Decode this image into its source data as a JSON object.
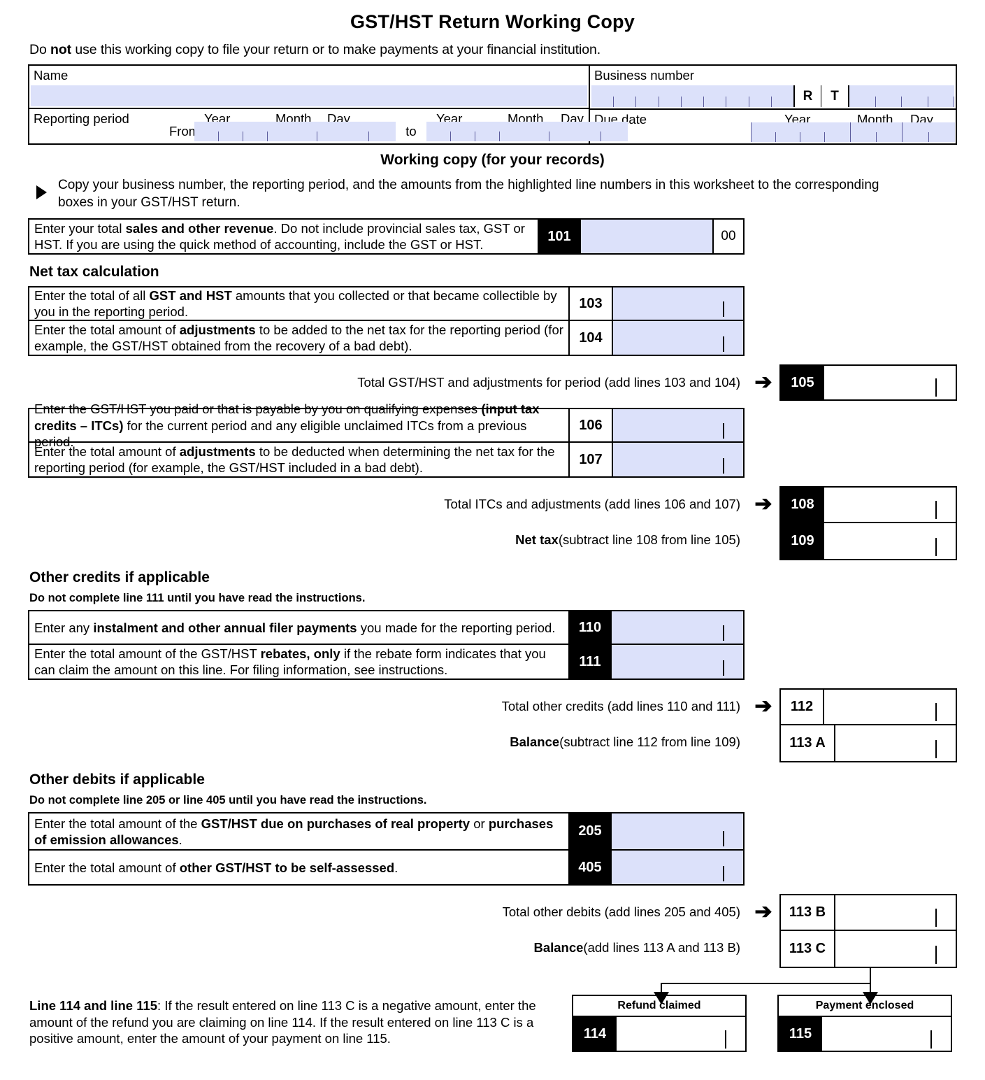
{
  "document": {
    "title": "GST/HST Return Working Copy",
    "subtitle_prefix": "Do ",
    "subtitle_bold": "not",
    "subtitle_suffix": " use this working copy to file your return or to make payments at your financial institution."
  },
  "identification": {
    "name_label": "Name",
    "business_number_label": "Business number",
    "rt_r": "R",
    "rt_t": "T",
    "reporting_period_label": "Reporting period",
    "from_label": "From",
    "to_label": "to",
    "due_date_label": "Due date",
    "year_label": "Year",
    "month_label": "Month",
    "day_label": "Day"
  },
  "working_copy": {
    "heading": "Working copy (for your records)",
    "instruction": "Copy your business number, the reporting period, and the amounts from the highlighted line numbers in this worksheet to the corresponding boxes in your GST/HST return."
  },
  "line_101": {
    "text_1": "Enter your total ",
    "bold_1": "sales and other revenue",
    "text_2": ". Do not include provincial sales tax, GST or HST. If you are using the quick method of accounting, include the GST or HST.",
    "number": "101",
    "cents": "00"
  },
  "net_tax": {
    "heading": "Net tax calculation",
    "line_103": {
      "text_1": "Enter the total of all ",
      "bold_1": "GST and HST",
      "text_2": " amounts that you collected or that became collectible by you in the reporting period.",
      "number": "103"
    },
    "line_104": {
      "text_1": "Enter the total amount of ",
      "bold_1": "adjustments",
      "text_2": " to be added to the net tax for the reporting period (for example, the GST/HST obtained from the recovery of a bad debt).",
      "number": "104"
    },
    "line_105": {
      "label": "Total GST/HST and adjustments for period (add lines 103 and 104)",
      "number": "105",
      "arrow": "➔"
    },
    "line_106": {
      "text_1": "Enter the GST/HST you paid or that is payable by you on qualifying expenses ",
      "bold_1": "(input tax credits – ITCs)",
      "text_2": " for the current period and any eligible unclaimed ITCs from a previous period.",
      "number": "106"
    },
    "line_107": {
      "text_1": "Enter the total amount of ",
      "bold_1": "adjustments",
      "text_2": " to be deducted when determining the net tax for the reporting period (for example, the GST/HST included in a bad debt).",
      "number": "107"
    },
    "line_108": {
      "label": "Total ITCs and adjustments (add lines 106 and 107)",
      "number": "108",
      "arrow": "➔"
    },
    "line_109": {
      "bold_label": "Net tax",
      "label": " (subtract line 108 from line 105)",
      "number": "109"
    }
  },
  "other_credits": {
    "heading": "Other credits if applicable",
    "subheading": "Do not complete line 111 until you have read the instructions.",
    "line_110": {
      "text_1": "Enter any ",
      "bold_1": "instalment and other annual filer payments",
      "text_2": " you made for the reporting period.",
      "number": "110"
    },
    "line_111": {
      "text_1": "Enter the total amount of the GST/HST ",
      "bold_1": "rebates, only",
      "text_2": " if the rebate form indicates that you can claim the amount on this line. For filing information, see instructions.",
      "number": "111"
    },
    "line_112": {
      "label": "Total other credits (add lines 110 and 111)",
      "number": "112",
      "arrow": "➔"
    },
    "line_113a": {
      "bold_label": "Balance",
      "label": " (subtract line 112 from line 109)",
      "number": "113 A"
    }
  },
  "other_debits": {
    "heading": "Other debits if applicable",
    "subheading": "Do not complete line 205 or line 405 until you have read the instructions.",
    "line_205": {
      "text_1": "Enter the total amount of the ",
      "bold_1": "GST/HST due on purchases of real property",
      "text_2": " or ",
      "bold_2": "purchases of emission allowances",
      "text_3": ".",
      "number": "205"
    },
    "line_405": {
      "text_1": "Enter the total amount of ",
      "bold_1": "other GST/HST to be self-assessed",
      "text_2": ".",
      "number": "405"
    },
    "line_113b": {
      "label": "Total other debits (add lines 205 and 405)",
      "number": "113 B",
      "arrow": "➔"
    },
    "line_113c": {
      "bold_label": "Balance",
      "label": " (add lines 113 A and 113 B)",
      "number": "113 C"
    }
  },
  "footer": {
    "note_bold": "Line 114 and line 115",
    "note_text": ": If the result entered on line 113 C is a negative amount, enter the amount of the refund you are claiming on line 114. If the result entered on line 113 C is a positive amount, enter the amount of your payment on line 115.",
    "refund": {
      "title": "Refund claimed",
      "number": "114"
    },
    "payment": {
      "title": "Payment enclosed",
      "number": "115"
    }
  },
  "colors": {
    "field_blue": "#dce1fa",
    "ink": "#000000"
  }
}
